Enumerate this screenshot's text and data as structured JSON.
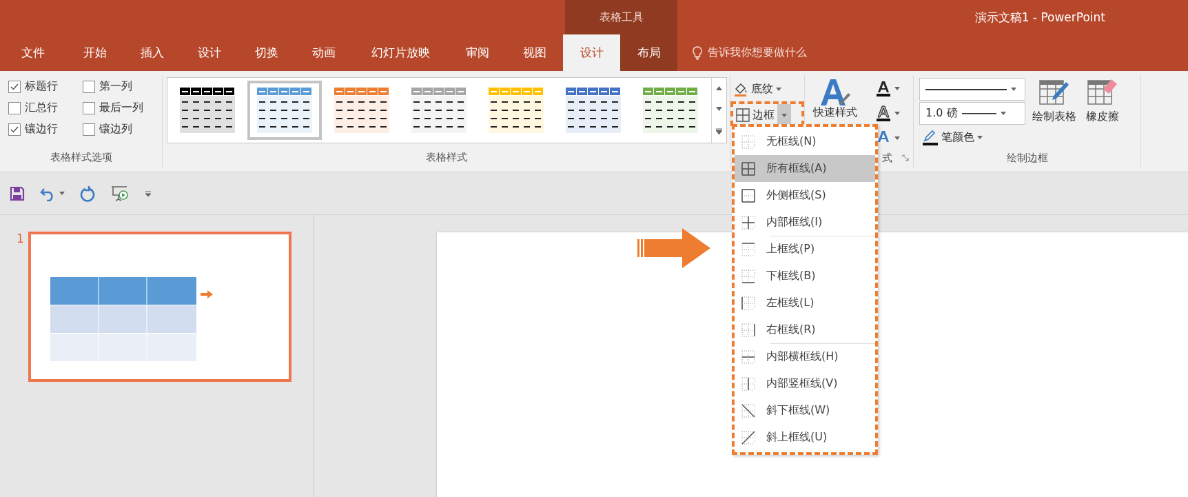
{
  "title_bar": {
    "context_label": "表格工具",
    "title": "演示文稿1 - PowerPoint"
  },
  "tabs": [
    {
      "label": "文件",
      "selected": false,
      "contextual": false
    },
    {
      "label": "开始",
      "selected": false,
      "contextual": false
    },
    {
      "label": "插入",
      "selected": false,
      "contextual": false
    },
    {
      "label": "设计",
      "selected": false,
      "contextual": false
    },
    {
      "label": "切换",
      "selected": false,
      "contextual": false
    },
    {
      "label": "动画",
      "selected": false,
      "contextual": false
    },
    {
      "label": "幻灯片放映",
      "selected": false,
      "contextual": false
    },
    {
      "label": "审阅",
      "selected": false,
      "contextual": false
    },
    {
      "label": "视图",
      "selected": false,
      "contextual": false
    },
    {
      "label": "设计",
      "selected": true,
      "contextual": true
    },
    {
      "label": "布局",
      "selected": false,
      "contextual": true
    }
  ],
  "tell_me": "告诉我你想要做什么",
  "style_options": {
    "label": "表格样式选项",
    "options": [
      {
        "label": "标题行",
        "checked": true
      },
      {
        "label": "第一列",
        "checked": false
      },
      {
        "label": "汇总行",
        "checked": false
      },
      {
        "label": "最后一列",
        "checked": false
      },
      {
        "label": "镶边行",
        "checked": true
      },
      {
        "label": "镶边列",
        "checked": false
      }
    ]
  },
  "table_styles": {
    "label": "表格样式",
    "styles": [
      {
        "color": "#000000",
        "selected": false
      },
      {
        "color": "#5b9bd5",
        "selected": true
      },
      {
        "color": "#ed7d31",
        "selected": false
      },
      {
        "color": "#a5a5a5",
        "selected": false
      },
      {
        "color": "#ffc000",
        "selected": false
      },
      {
        "color": "#4472c4",
        "selected": false
      },
      {
        "color": "#70ad47",
        "selected": false
      }
    ]
  },
  "shading": "底纹",
  "borders": "边框",
  "wordart": {
    "quick_styles": "快速样式",
    "group_label": "式"
  },
  "draw_borders": {
    "label": "绘制边框",
    "pen_weight": "1.0 磅",
    "pen_color": "笔颜色",
    "draw_table": "绘制表格",
    "eraser": "橡皮擦"
  },
  "slides": [
    {
      "number": "1",
      "selected": true
    }
  ],
  "border_menu": [
    {
      "label": "无框线(N)",
      "kind": "none",
      "separator_before": false,
      "selected": false
    },
    {
      "label": "所有框线(A)",
      "kind": "all",
      "separator_before": false,
      "selected": true
    },
    {
      "label": "外侧框线(S)",
      "kind": "outside",
      "separator_before": false,
      "selected": false
    },
    {
      "label": "内部框线(I)",
      "kind": "inside",
      "separator_before": false,
      "selected": false
    },
    {
      "label": "上框线(P)",
      "kind": "top",
      "separator_before": true,
      "selected": false
    },
    {
      "label": "下框线(B)",
      "kind": "bottom",
      "separator_before": false,
      "selected": false
    },
    {
      "label": "左框线(L)",
      "kind": "left",
      "separator_before": false,
      "selected": false
    },
    {
      "label": "右框线(R)",
      "kind": "right",
      "separator_before": false,
      "selected": false
    },
    {
      "label": "内部横框线(H)",
      "kind": "inside_h",
      "separator_before": true,
      "selected": false
    },
    {
      "label": "内部竖框线(V)",
      "kind": "inside_v",
      "separator_before": false,
      "selected": false
    },
    {
      "label": "斜下框线(W)",
      "kind": "diag_down",
      "separator_before": false,
      "selected": false
    },
    {
      "label": "斜上框线(U)",
      "kind": "diag_up",
      "separator_before": false,
      "selected": false
    }
  ]
}
